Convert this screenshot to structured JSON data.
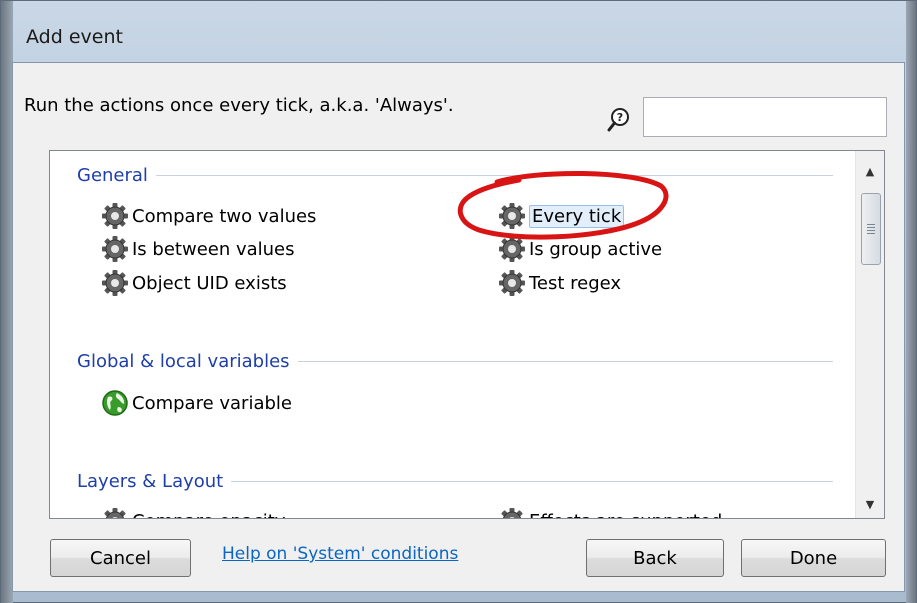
{
  "dialog": {
    "title": "Add event",
    "description": "Run the actions once every tick, a.k.a. 'Always'."
  },
  "search": {
    "value": "",
    "placeholder": "",
    "icon": "search-help-icon"
  },
  "groups": [
    {
      "name": "General",
      "items": [
        {
          "label": "Compare two values",
          "icon": "gear-icon"
        },
        {
          "label": "Is between values",
          "icon": "gear-icon"
        },
        {
          "label": "Object UID exists",
          "icon": "gear-icon"
        },
        {
          "label": "Every tick",
          "icon": "gear-icon",
          "selected": true
        },
        {
          "label": "Is group active",
          "icon": "gear-icon"
        },
        {
          "label": "Test regex",
          "icon": "gear-icon"
        }
      ]
    },
    {
      "name": "Global & local variables",
      "items": [
        {
          "label": "Compare variable",
          "icon": "globe-icon"
        }
      ]
    },
    {
      "name": "Layers & Layout",
      "items": [
        {
          "label": "Compare opacity",
          "icon": "gear-icon"
        },
        {
          "label": "Effects are supported",
          "icon": "gear-icon"
        }
      ]
    }
  ],
  "buttons": {
    "cancel": "Cancel",
    "help": "Help on 'System' conditions",
    "back": "Back",
    "done": "Done"
  },
  "colors": {
    "group_header": "#1e3fa8",
    "link": "#0b66c2",
    "annotation_circle": "#d81414"
  }
}
